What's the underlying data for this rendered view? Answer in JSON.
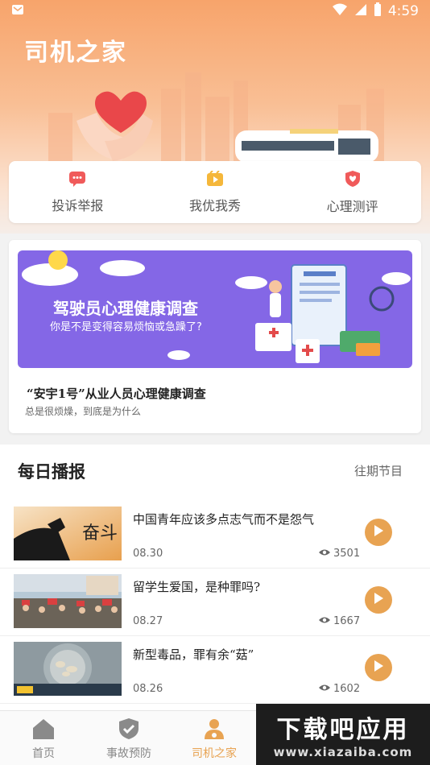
{
  "statusbar": {
    "time": "4:59"
  },
  "header": {
    "title": "司机之家"
  },
  "quick_actions": [
    {
      "label": "投诉举报",
      "icon": "message-icon",
      "color": "#f05a5a"
    },
    {
      "label": "我优我秀",
      "icon": "video-icon",
      "color": "#f5b73a"
    },
    {
      "label": "心理测评",
      "icon": "heart-shield-icon",
      "color": "#f05a5a"
    }
  ],
  "survey": {
    "banner_title": "驾驶员心理健康调查",
    "banner_subtitle": "你是不是变得容易烦恼或急躁了?",
    "title": "“安宇1号”从业人员心理健康调查",
    "subtitle": "总是很烦燥，到底是为什么"
  },
  "daily": {
    "title": "每日播报",
    "more_label": "往期节目",
    "items": [
      {
        "title": "中国青年应该多点志气而不是怨气",
        "date": "08.30",
        "views": "3501"
      },
      {
        "title": "留学生爱国，是种罪吗?",
        "date": "08.27",
        "views": "1667"
      },
      {
        "title": "新型毒品，罪有余“菇”",
        "date": "08.26",
        "views": "1602"
      }
    ]
  },
  "nav": {
    "items": [
      {
        "label": "首页",
        "icon": "home-icon"
      },
      {
        "label": "事故预防",
        "icon": "shield-check-icon"
      },
      {
        "label": "司机之家",
        "icon": "driver-icon"
      }
    ],
    "active_index": 2
  },
  "watermark": {
    "main": "下载吧应用",
    "sub": "www.xiazaiba.com"
  },
  "colors": {
    "accent": "#e8a352",
    "banner": "#8467e6",
    "hero": "#f7a46b"
  }
}
